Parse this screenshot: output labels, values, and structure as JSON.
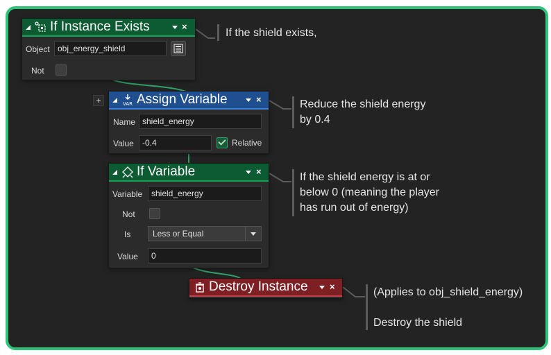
{
  "blocks": {
    "if_instance_exists": {
      "title": "If Instance Exists",
      "object_label": "Object",
      "object_value": "obj_energy_shield",
      "not_label": "Not"
    },
    "assign_variable": {
      "title": "Assign Variable",
      "name_label": "Name",
      "name_value": "shield_energy",
      "value_label": "Value",
      "value_value": "-0.4",
      "relative_label": "Relative",
      "relative_checked": true
    },
    "if_variable": {
      "title": "If Variable",
      "variable_label": "Variable",
      "variable_value": "shield_energy",
      "not_label": "Not",
      "is_label": "Is",
      "is_value": "Less or Equal",
      "value_label": "Value",
      "value_value": "0"
    },
    "destroy_instance": {
      "title": "Destroy Instance"
    }
  },
  "controls": {
    "close_glyph": "×",
    "add_glyph": "+"
  },
  "comments": {
    "c1": "If the shield exists,",
    "c2_line1": "Reduce the shield energy",
    "c2_line2": "by 0.4",
    "c3_line1": "If the shield energy is at or",
    "c3_line2": "below 0 (meaning the player",
    "c3_line3": "has run out of energy)",
    "c4_line1": "(Applies to obj_shield_energy)",
    "c4_line2": "Destroy the shield"
  },
  "colors": {
    "frame_border": "#2fc37a",
    "canvas": "#232323",
    "header_green": "#0d5b33",
    "header_blue": "#1f4f8f",
    "header_red": "#7e1f24",
    "wire": "#2fa36a"
  }
}
